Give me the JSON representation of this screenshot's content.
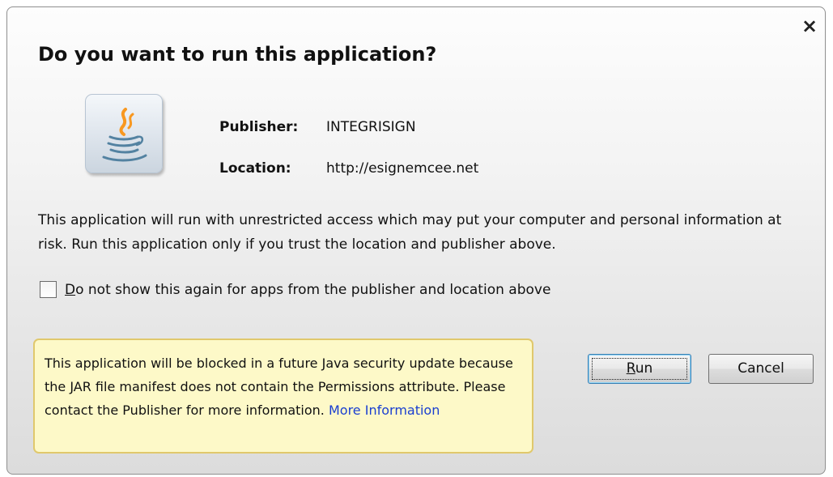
{
  "dialog": {
    "close_glyph": "×",
    "title": "Do you want to run this application?",
    "icon": "java-icon",
    "publisher_label": "Publisher:",
    "publisher_value": "INTEGRISIGN",
    "location_label": "Location:",
    "location_value": "http://esignemcee.net",
    "warning": "This application will run with unrestricted access which may put your computer and personal information at risk. Run this application only if you trust the location and publisher above.",
    "checkbox": {
      "mnemonic": "D",
      "label_rest": "o not show this again for apps from the publisher and location above",
      "checked": false
    },
    "note": {
      "text": "This application will be blocked in a future Java security update because the JAR file manifest does not contain the Permissions attribute. Please contact the Publisher for more information. ",
      "link": "More Information"
    },
    "buttons": {
      "run_mnemonic": "R",
      "run_rest": "un",
      "cancel": "Cancel"
    }
  },
  "colors": {
    "note_background": "#fdf9c8",
    "note_border": "#e0c86c",
    "link": "#1a3fd1",
    "java_blue": "#5382a1",
    "java_orange": "#f89820"
  }
}
